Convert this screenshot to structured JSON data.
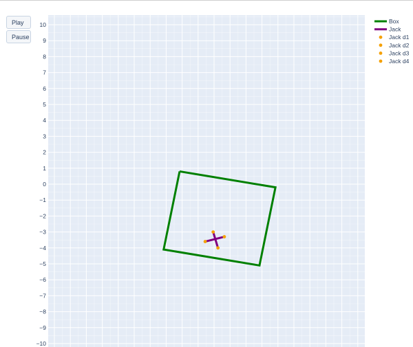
{
  "controls": {
    "play_label": "Play",
    "pause_label": "Pause"
  },
  "chart_data": {
    "type": "line",
    "title": "",
    "xlabel": "",
    "ylabel": "",
    "ylim": [
      -10,
      10
    ],
    "yticks": [
      10,
      9,
      8,
      7,
      6,
      5,
      4,
      3,
      2,
      1,
      0,
      -1,
      -2,
      -3,
      -4,
      -5,
      -6,
      -7,
      -8,
      -9,
      -10
    ],
    "ytick_labels": [
      "10",
      "9",
      "8",
      "7",
      "6",
      "5",
      "4",
      "3",
      "2",
      "1",
      "0",
      "−1",
      "−2",
      "−3",
      "−4",
      "−5",
      "−6",
      "−7",
      "−8",
      "−9",
      "−10"
    ],
    "grid": true,
    "legend_position": "top-right",
    "plot_bg": "#e5ecf6",
    "series": [
      {
        "name": "Box",
        "mode": "lines",
        "color": "#008000",
        "x": [
          -2.2,
          3.8,
          2.8,
          -3.2,
          -2.2
        ],
        "y": [
          0.8,
          -0.2,
          -5.1,
          -4.1,
          0.8
        ]
      },
      {
        "name": "Jack",
        "mode": "lines",
        "color": "#800080",
        "segments": [
          {
            "x": [
              -0.1,
              0.2
            ],
            "y": [
              -3.0,
              -4.0
            ]
          },
          {
            "x": [
              -0.6,
              0.6
            ],
            "y": [
              -3.6,
              -3.3
            ]
          }
        ]
      },
      {
        "name": "Jack d1",
        "mode": "markers",
        "color": "#f5a000",
        "x": [
          -0.1
        ],
        "y": [
          -3.0
        ]
      },
      {
        "name": "Jack d2",
        "mode": "markers",
        "color": "#f5a000",
        "x": [
          0.2
        ],
        "y": [
          -4.0
        ]
      },
      {
        "name": "Jack d3",
        "mode": "markers",
        "color": "#f5a000",
        "x": [
          -0.6
        ],
        "y": [
          -3.6
        ]
      },
      {
        "name": "Jack d4",
        "mode": "markers",
        "color": "#f5a000",
        "x": [
          0.6
        ],
        "y": [
          -3.3
        ]
      }
    ]
  }
}
